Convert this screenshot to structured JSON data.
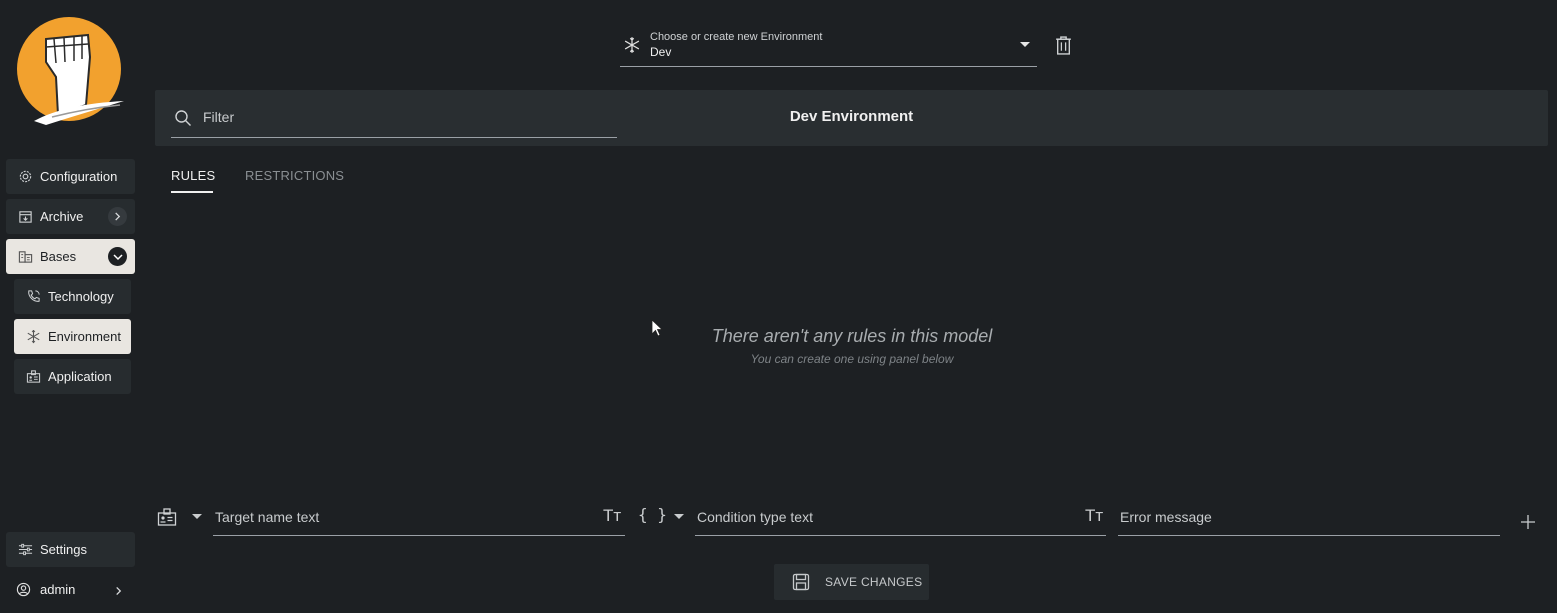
{
  "sidebar": {
    "items": [
      {
        "label": "Configuration",
        "icon": "gear-icon"
      },
      {
        "label": "Archive",
        "icon": "archive-icon"
      },
      {
        "label": "Bases",
        "icon": "buildings-icon"
      },
      {
        "label": "Technology",
        "icon": "phone-icon"
      },
      {
        "label": "Environment",
        "icon": "snowflake-icon"
      },
      {
        "label": "Application",
        "icon": "badge-icon"
      }
    ],
    "settings_label": "Settings",
    "user_label": "admin"
  },
  "environment_select": {
    "label": "Choose or create new Environment",
    "value": "Dev"
  },
  "header": {
    "filter_placeholder": "Filter",
    "title": "Dev Environment"
  },
  "tabs": [
    {
      "label": "RULES",
      "active": true
    },
    {
      "label": "RESTRICTIONS",
      "active": false
    }
  ],
  "empty_state": {
    "title": "There aren't any rules in this model",
    "subtitle": "You can create one using panel below"
  },
  "rule_panel": {
    "target_placeholder": "Target name text",
    "condition_placeholder": "Condition type text",
    "error_placeholder": "Error message",
    "text_type_glyph": "Tт",
    "braces_glyph": "{ }"
  },
  "save_button": {
    "label": "SAVE CHANGES"
  },
  "colors": {
    "background": "#1d2023",
    "panel": "#292e31",
    "active_nav": "#e9e6e1",
    "logo_orange": "#f2a12e"
  }
}
